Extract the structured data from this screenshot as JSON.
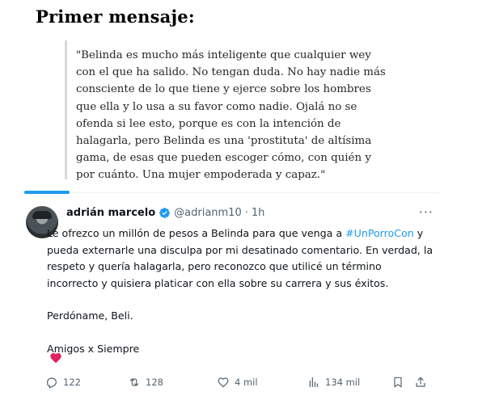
{
  "heading": "Primer mensaje:",
  "quote": "\"Belinda es mucho más inteligente que cualquier wey con el que ha salido. No tengan duda. No hay nadie más consciente de lo que tiene y ejerce sobre los hombres que ella y lo usa a su favor como nadie. Ojalá no se ofenda si lee esto, porque es con la intención de halagarla, pero Belinda es una 'prostituta' de altísima gama, de esas que pueden escoger cómo, con quién y por cuánto. Una mujer empoderada y capaz.\"",
  "tweet": {
    "display_name": "adrián marcelo",
    "handle": "@adrianm10",
    "dot": "·",
    "time": "1h",
    "more": "···",
    "body_before": "Le ofrezco un millón de pesos a Belinda para que venga a ",
    "hashtag": "#UnPorroCon",
    "body_after": " y pueda externarle una disculpa por mi desatinado comentario. En verdad, la respeto y quería halagarla, pero reconozco que utilicé un término incorrecto y quisiera platicar con ella sobre su carrera y sus éxitos.",
    "line2": "Perdóname, Beli.",
    "line3": "Amigos x Siempre",
    "emoji": "heart-emoji",
    "accent_color": "#1d9bf0",
    "heart_color": "#e0245e"
  },
  "actions": {
    "replies": "122",
    "retweets": "128",
    "likes": "4 mil",
    "views": "134 mil"
  }
}
